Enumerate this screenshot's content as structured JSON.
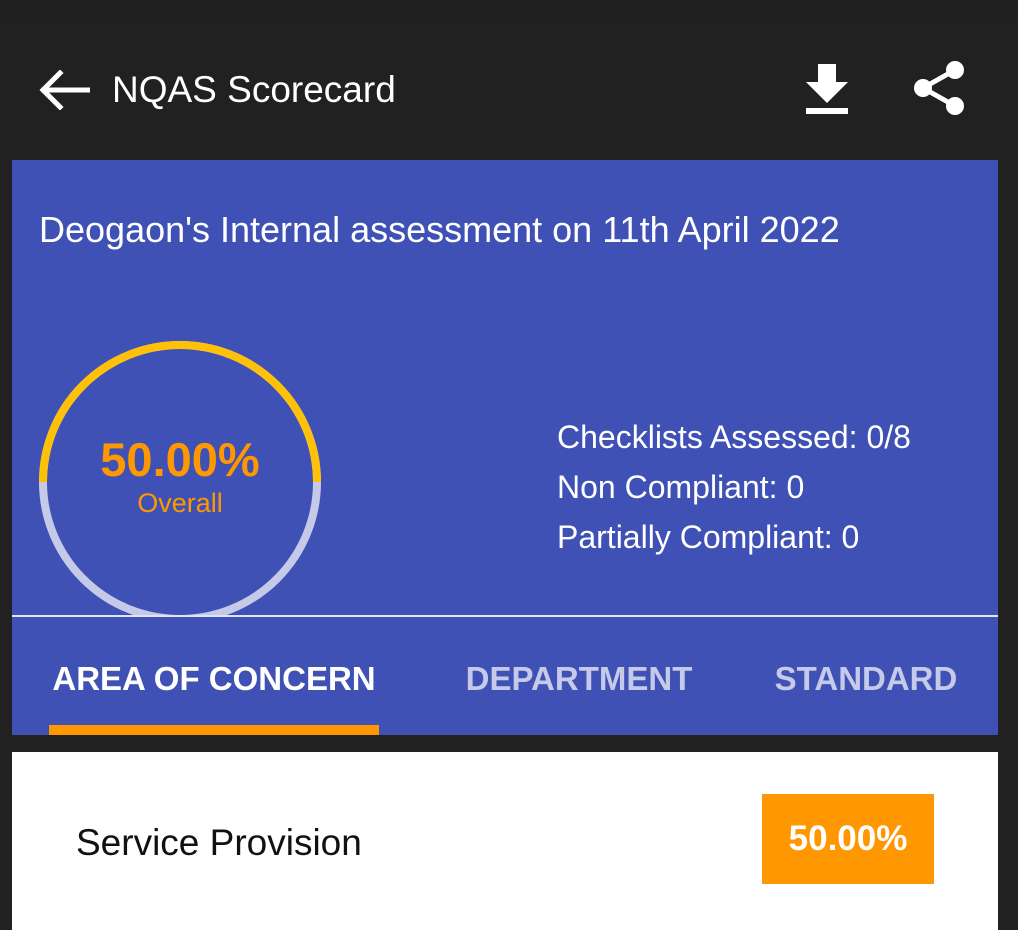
{
  "app_bar": {
    "title": "NQAS Scorecard",
    "back_icon": "arrow-left-icon",
    "download_icon": "download-icon",
    "share_icon": "share-icon"
  },
  "summary": {
    "title": "Deogaon's Internal assessment on 11th April 2022",
    "overall_percent": "50.00%",
    "overall_label": "Overall",
    "overall_fraction": 0.5,
    "stats": {
      "checklists": "Checklists Assessed: 0/8",
      "non_compliant": "Non Compliant: 0",
      "partially_compliant": "Partially Compliant: 0"
    }
  },
  "tabs": [
    {
      "label": "AREA OF CONCERN",
      "active": true
    },
    {
      "label": "DEPARTMENT",
      "active": false
    },
    {
      "label": "STANDARD",
      "active": false
    }
  ],
  "rows": [
    {
      "label": "Service Provision",
      "score": "50.00%"
    }
  ],
  "colors": {
    "primary": "#3f51b5",
    "accent": "#ff9800",
    "gauge_progress": "#ffc107",
    "gauge_track": "#c5cae9",
    "app_bar": "#212121"
  }
}
